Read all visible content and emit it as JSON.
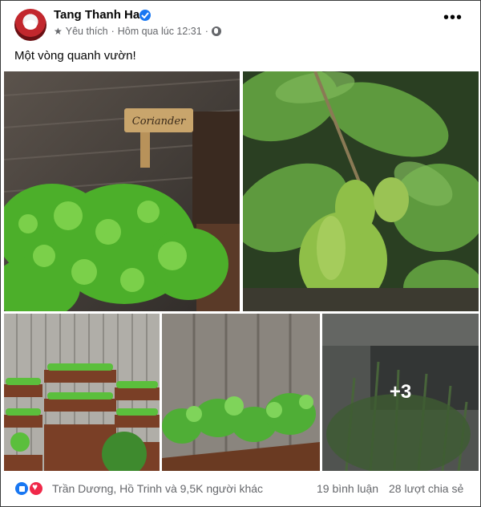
{
  "post": {
    "author": "Tang Thanh Ha",
    "meta": {
      "favorite": "Yêu thích",
      "separator": "·",
      "time": "Hôm qua lúc 12:31",
      "separator2": "·"
    },
    "caption": "Một vòng quanh vườn!",
    "photos": [
      {
        "label": "Coriander",
        "description": ""
      },
      {
        "description": ""
      },
      {
        "description": ""
      },
      {
        "description": ""
      },
      {
        "overlay": "+3"
      }
    ],
    "footer": {
      "reactions_text": "Trần Dương, Hồ Trinh và 9,5K người khác",
      "comments": "19 bình luận",
      "shares": "28 lượt chia sẻ"
    }
  },
  "colors": {
    "verified": "#1877f2",
    "like": "#1877f2",
    "love": "#f02849",
    "secondary_text": "#65676b"
  }
}
